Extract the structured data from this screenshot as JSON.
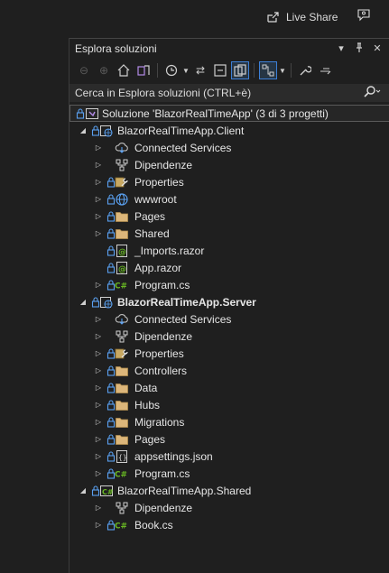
{
  "topbar": {
    "live_share": "Live Share"
  },
  "panel": {
    "title": "Esplora soluzioni",
    "search_placeholder": "Cerca in Esplora soluzioni (CTRL+è)"
  },
  "solution": {
    "label": "Soluzione 'BlazorRealTimeApp' (3 di 3 progetti)"
  },
  "client": {
    "name": "BlazorRealTimeApp.Client",
    "items": [
      "Connected Services",
      "Dipendenze",
      "Properties",
      "wwwroot",
      "Pages",
      "Shared",
      "_Imports.razor",
      "App.razor",
      "Program.cs"
    ]
  },
  "server": {
    "name": "BlazorRealTimeApp.Server",
    "items": [
      "Connected Services",
      "Dipendenze",
      "Properties",
      "Controllers",
      "Data",
      "Hubs",
      "Migrations",
      "Pages",
      "appsettings.json",
      "Program.cs"
    ]
  },
  "shared": {
    "name": "BlazorRealTimeApp.Shared",
    "items": [
      "Dipendenze",
      "Book.cs"
    ]
  },
  "colors": {
    "folder": "#dcb67a",
    "accent": "#3c7fd6",
    "csharp": "#68b723",
    "razor": "#68b723"
  }
}
